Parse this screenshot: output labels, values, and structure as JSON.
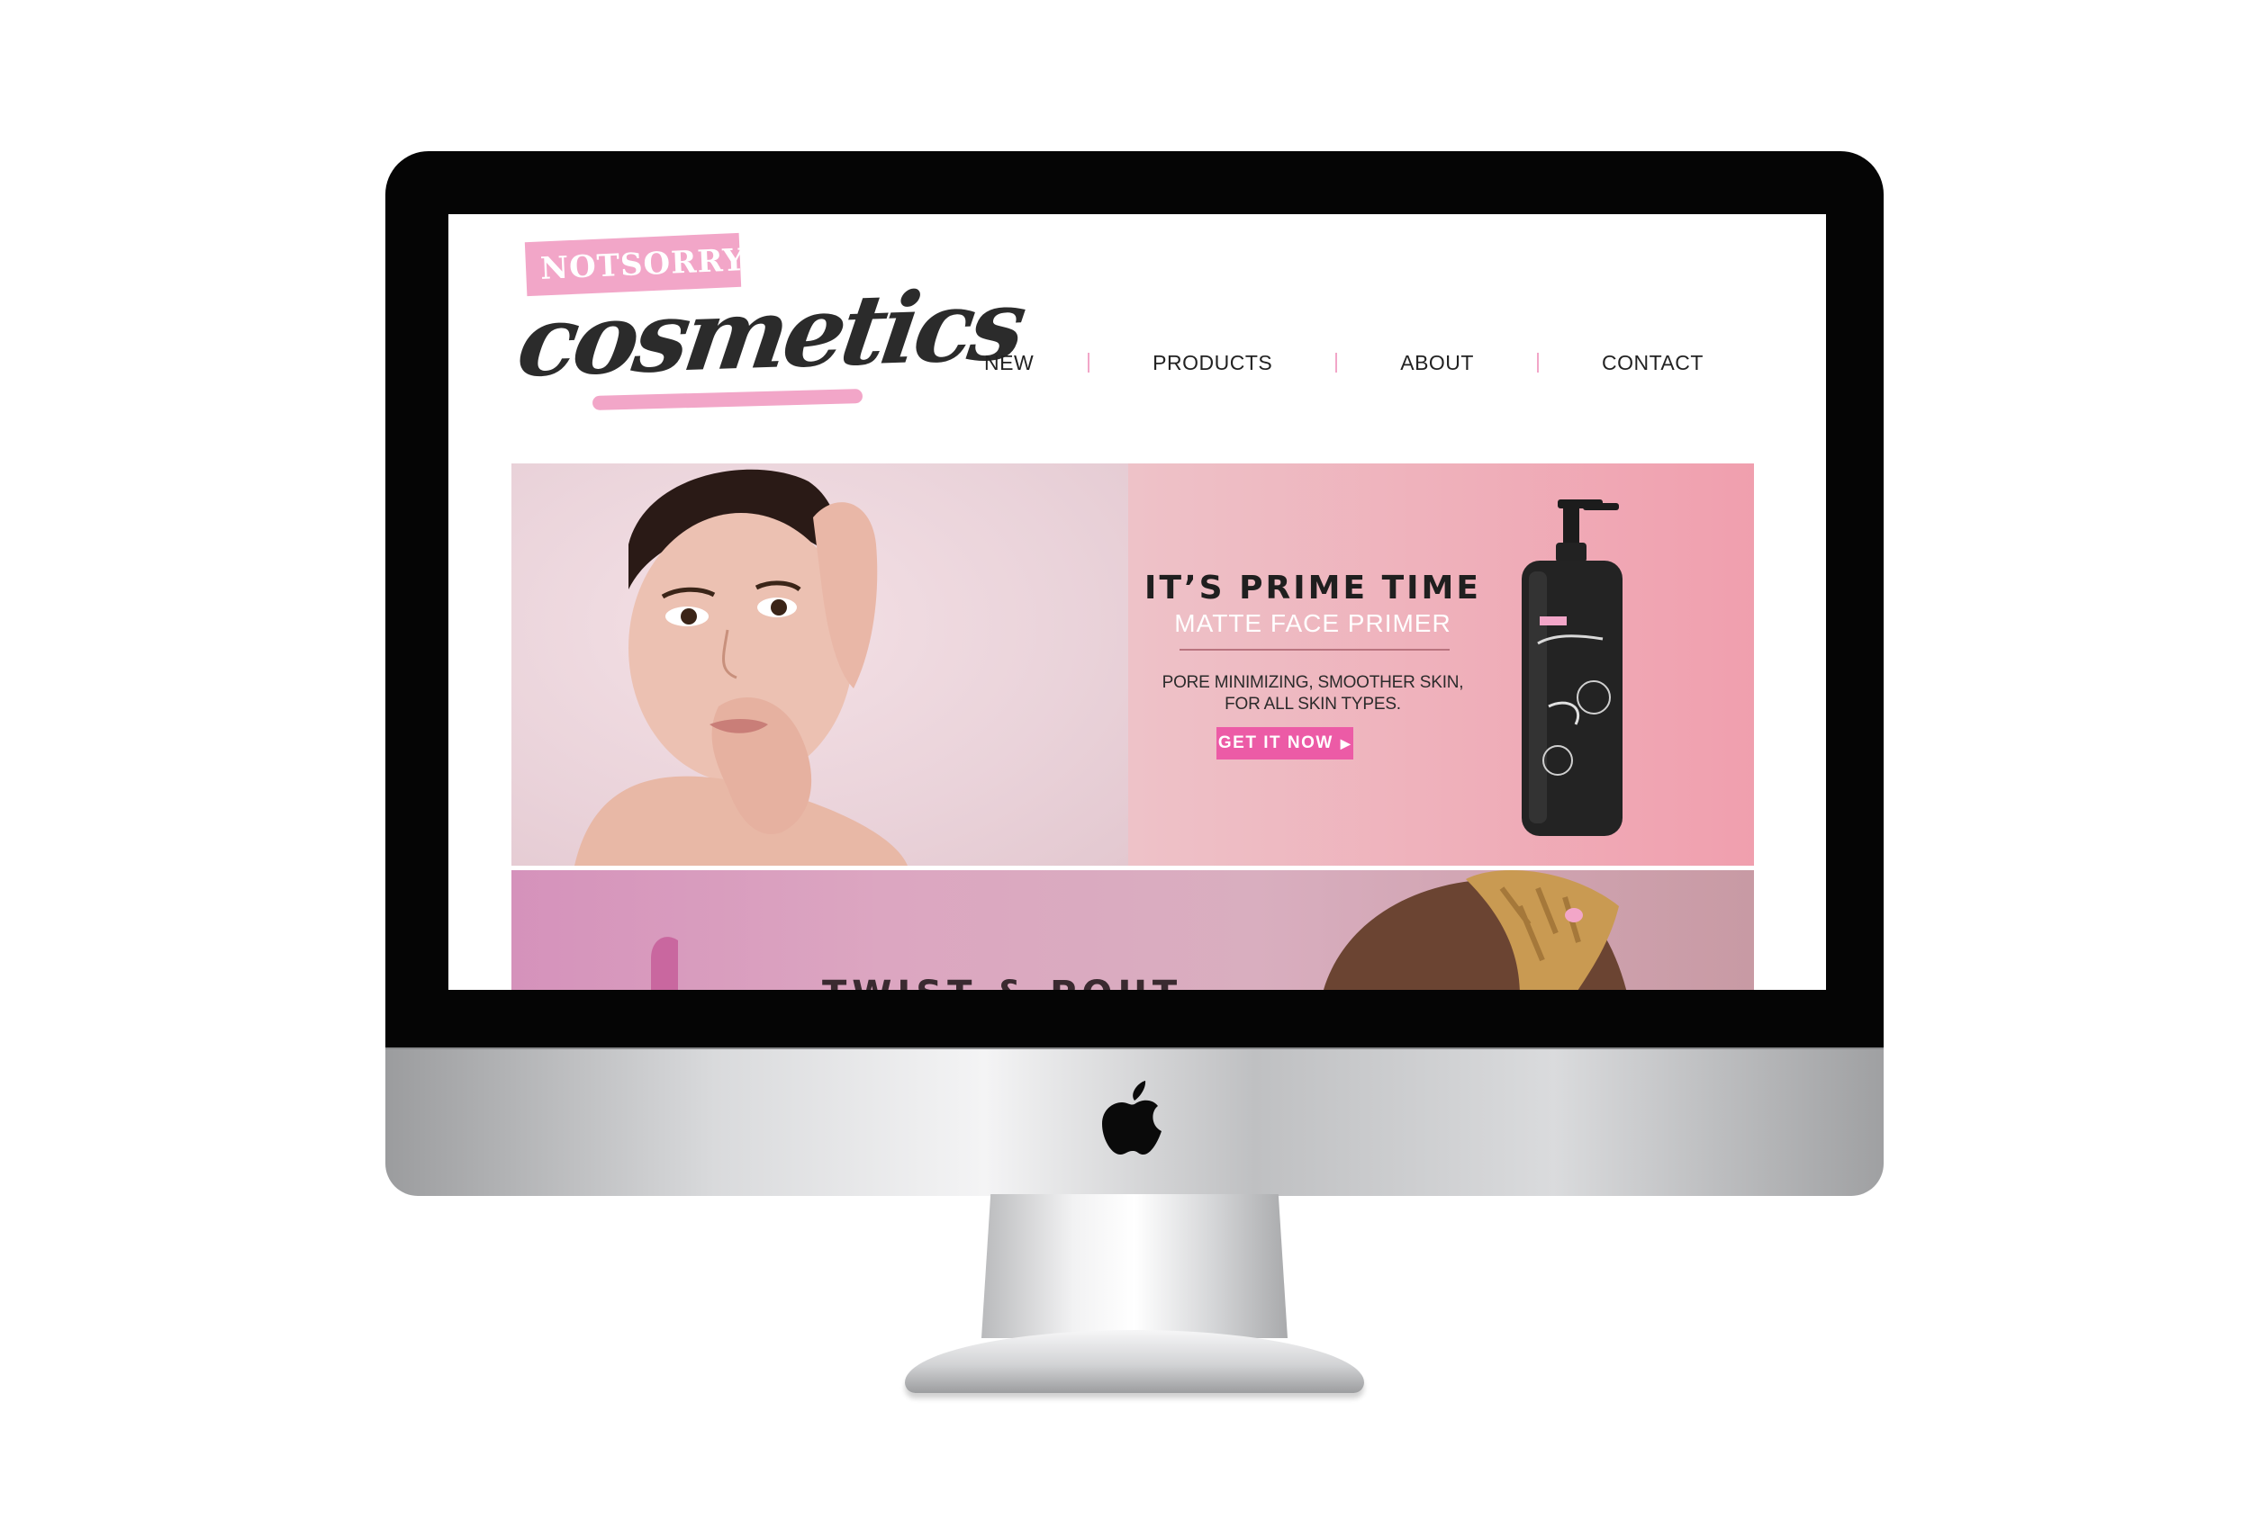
{
  "brand": {
    "tag": "NOTSORRY",
    "name": "cosmetics",
    "accent_color": "#f2a6c8"
  },
  "nav": {
    "items": [
      "NEW",
      "PRODUCTS",
      "ABOUT",
      "CONTACT"
    ]
  },
  "hero": {
    "title": "IT’S PRIME TIME",
    "subtitle": "MATTE FACE PRIMER",
    "description_line1": "PORE MINIMIZING, SMOOTHER SKIN,",
    "description_line2": "FOR ALL SKIN TYPES.",
    "cta_label": "GET IT NOW",
    "cta_color": "#ec5ba6"
  },
  "banner2": {
    "title": "TWIST & POUT"
  },
  "icons": [
    "apple-logo-icon",
    "arrow-right-icon"
  ]
}
